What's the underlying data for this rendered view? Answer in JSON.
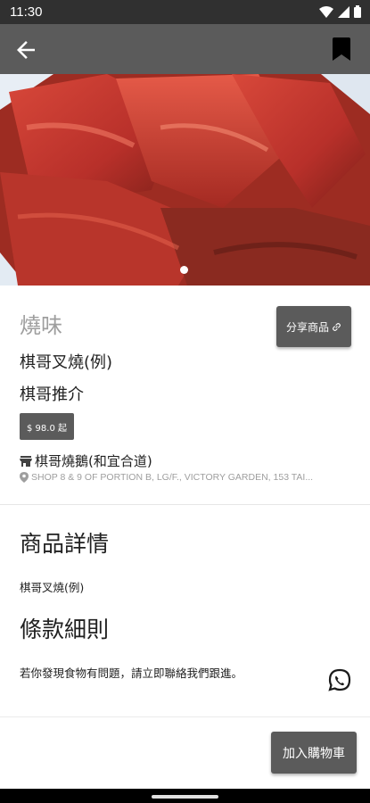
{
  "status_bar": {
    "time": "11:30"
  },
  "toolbar": {
    "back_icon": "arrow-left-icon",
    "bookmark_icon": "bookmark-icon"
  },
  "hero": {
    "image_desc": "char-siu-photo",
    "page_indicator": {
      "count": 1,
      "active": 0
    }
  },
  "product": {
    "category": "燒味",
    "name": "棋哥叉燒(例)",
    "recommend": "棋哥推介",
    "price": "$ 98.0 起",
    "shop_name": "棋哥燒鵝(和宜合道)",
    "address": "SHOP 8 & 9 OF PORTION B, LG/F., VICTORY GARDEN, 153 TAI..."
  },
  "share_button": {
    "label": "分享商品"
  },
  "details": {
    "heading": "商品詳情",
    "text": "棋哥叉燒(例)"
  },
  "terms": {
    "heading": "條款細則",
    "text": "若你發現食物有問題，請立即聯絡我們跟進。"
  },
  "cart_button": {
    "label": "加入購物車"
  },
  "colors": {
    "toolbar": "#5b5b5b",
    "status_bar": "#303030",
    "button": "#5b5b5b",
    "muted_text": "#9e9e9e"
  }
}
